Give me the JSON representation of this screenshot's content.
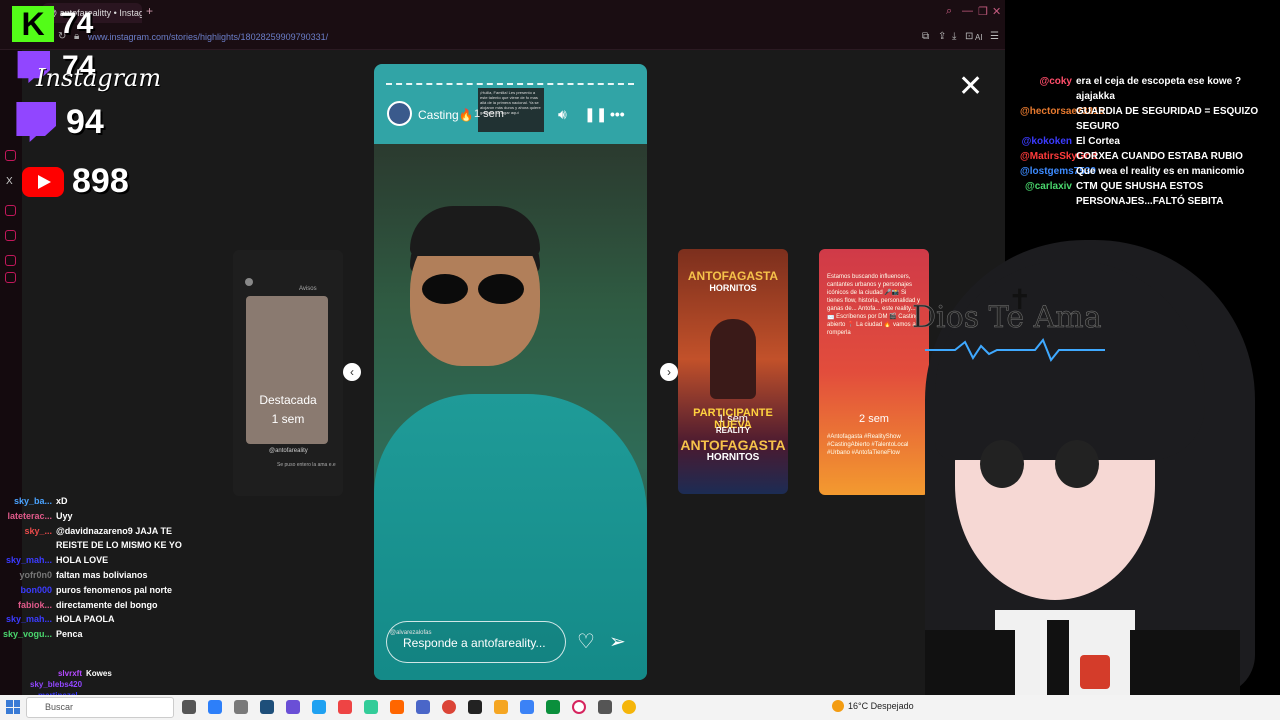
{
  "browser": {
    "tab_title": "@ antofarealitty • Instagram",
    "new_tab": "+",
    "url": "www.instagram.com/stories/highlights/18028259909790331/",
    "toolbar_ai": "AI"
  },
  "stream_stats": {
    "kick_letter": "K",
    "kick_count": "74",
    "instagram_count": "74",
    "instagram_word": "Instagram",
    "twitch_count": "94",
    "youtube_count": "898",
    "x_label": "X"
  },
  "story": {
    "username": "Casting🔥",
    "time": "1 sem",
    "caption_text": "¡Huilla, Familia! Les presento a este talento que viene de fo mas allá de la primera nacional. Ya se alojaron más duros y ahora quiere ganarse su lugar aquí",
    "reply_placeholder": "Responde a antofareality...",
    "video_tag": "@alvarezalofas"
  },
  "cards": {
    "left": {
      "header": "Avisos",
      "title": "Destacada",
      "time": "1 sem",
      "handle": "@antofareality",
      "footer": "Se puso entero la ama e.e"
    },
    "middle": {
      "brand_top": "ANTOFAGASTA",
      "brand_top_sub": "HORNITOS",
      "time": "1 sem",
      "label1": "PARTICIPANTE NUEVA",
      "label2": "REALITY",
      "brand_bottom": "ANTOFAGASTA",
      "brand_bottom_sub": "HORNITOS"
    },
    "right": {
      "text": "Estamos buscando influencers, cantantes urbanos y personajes icónicos de la ciudad 🎤📸 Si tienes flow, historia, personalidad y ganas de... Antofa... este reality... 📩 Escríbenos por DM 🎬 Casting abierto 📍 La ciudad 🔥 vamos a romperla",
      "time": "2 sem",
      "tags": "#Antofagasta #RealityShow #CastingAbierto #TalentoLocal #Urbano #AntofaTieneFlow"
    }
  },
  "controls": {
    "close": "X",
    "prev": "‹",
    "next": "›"
  },
  "chat_right": [
    {
      "user": "@coky",
      "color": "#ff4d6a",
      "msg": "era el ceja de escopeta ese kowe ? ajajakka"
    },
    {
      "user": "@hectorsaez3315",
      "color": "#e87a2f",
      "msg": "GUARDIA DE SEGURIDAD = ESQUIZO SEGURO"
    },
    {
      "user": "@kokoken",
      "color": "#3b3bff",
      "msg": "El Cortea"
    },
    {
      "user": "@MatirsSkyGod",
      "color": "#ff3b3b",
      "msg": "CORXEA CUANDO ESTABA RUBIO"
    },
    {
      "user": "@lostgems7530",
      "color": "#3d8bff",
      "msg": "Que wea el reality es en manicomio"
    },
    {
      "user": "@carlaxiv",
      "color": "#4ad66d",
      "msg": "CTM QUE SHUSHA ESTOS PERSONAJES...FALTÓ SEBITA"
    }
  ],
  "chat_left": [
    {
      "user": "sky_ba...",
      "color": "#4aa3ff",
      "msg": "xD"
    },
    {
      "user": "lateterac...",
      "color": "#e05a8a",
      "msg": "Uyy"
    },
    {
      "user": "sky_...",
      "color": "#e84a4a",
      "msg": "@davidnazareno9 JAJA TE REISTE DE LO MISMO KE YO"
    },
    {
      "user": "sky_mah...",
      "color": "#3b3bff",
      "msg": "HOLA LOVE"
    },
    {
      "user": "yofr0n0",
      "color": "#777777",
      "msg": "faltan mas bolivianos"
    },
    {
      "user": "bon000",
      "color": "#3b3bff",
      "msg": "puros fenomenos pal norte"
    },
    {
      "user": "fabiok...",
      "color": "#e05a8a",
      "msg": "directamente del bongo"
    },
    {
      "user": "sky_mah...",
      "color": "#3b3bff",
      "msg": "HOLA PAOLA"
    },
    {
      "user": "sky_vogu...",
      "color": "#4ad66d",
      "msg": "Penca"
    }
  ],
  "chat_left_bottom": [
    {
      "user": "slvrxft",
      "color": "#b44aff",
      "msg": "Kowes"
    },
    {
      "user": "sky_blebs420",
      "color": "#9146ff",
      "msg": ""
    },
    {
      "user": "martinezcl_",
      "color": "#3b3bff",
      "msg": ""
    }
  ],
  "overlay_text": {
    "dios": "Dios Te Ama"
  },
  "taskbar": {
    "search_placeholder": "Buscar",
    "weather": "16°C  Despejado"
  }
}
